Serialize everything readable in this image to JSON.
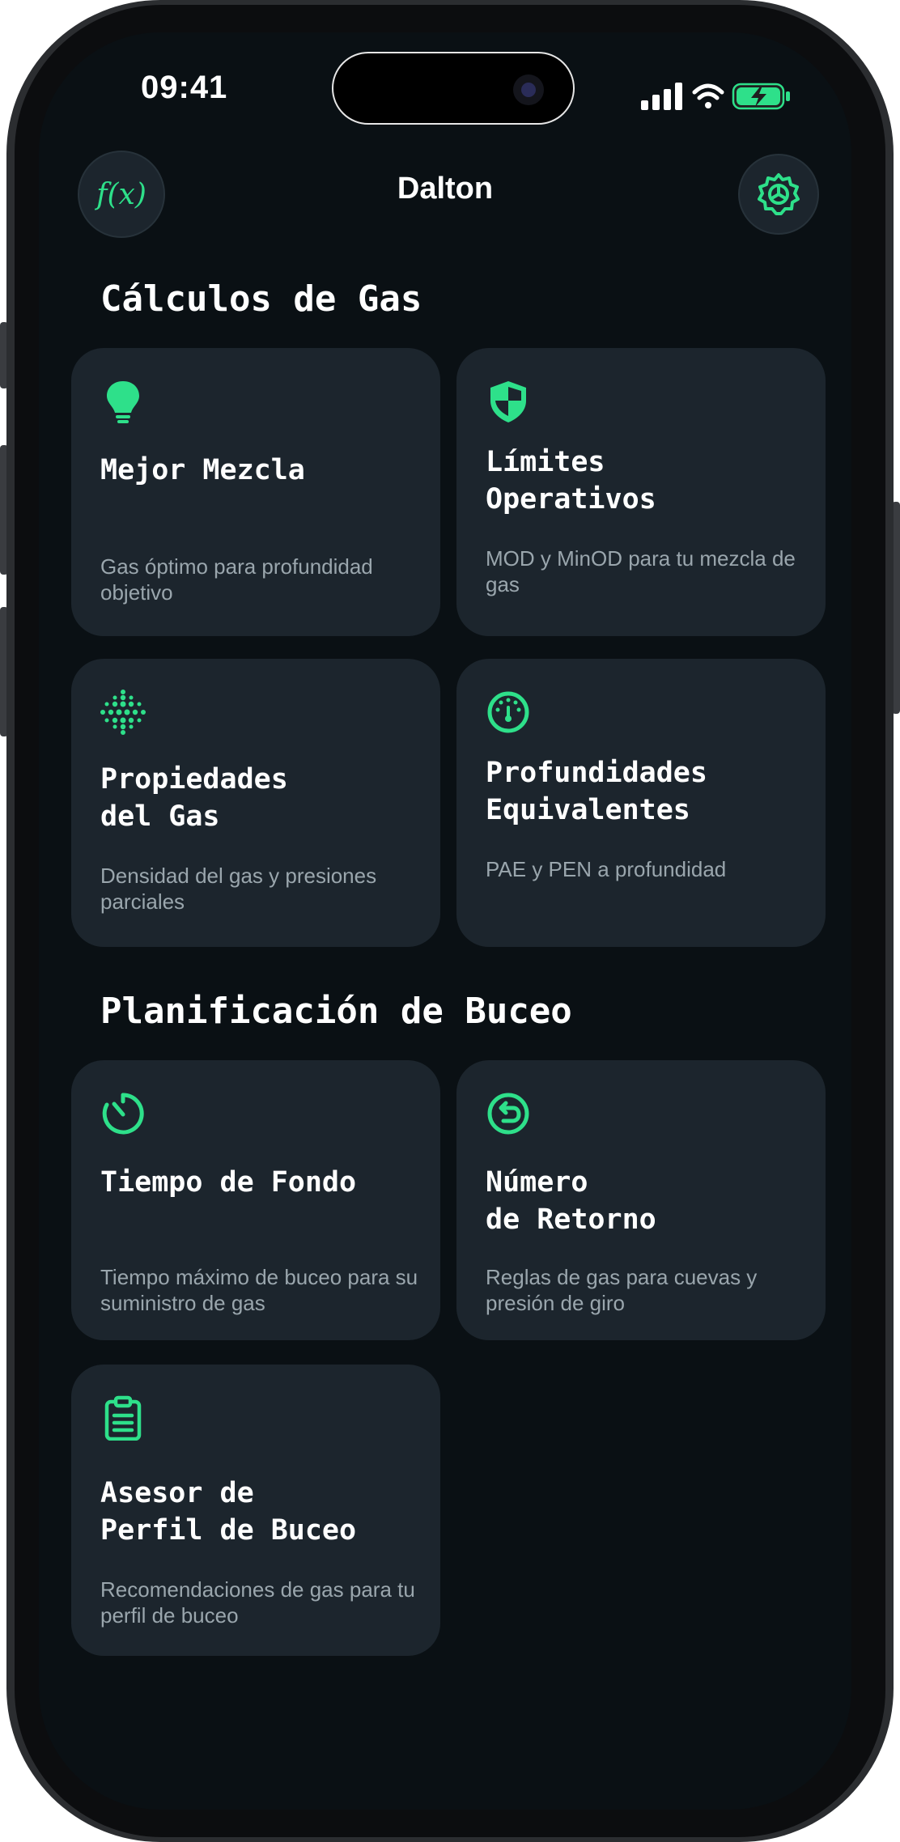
{
  "status_bar": {
    "time": "09:41"
  },
  "nav": {
    "title": "Dalton",
    "left_button_icon": "function-icon",
    "left_button_text": "f(x)",
    "right_button_icon": "gear-icon"
  },
  "colors": {
    "accent": "#2ee08a",
    "card": "#1c252d",
    "background": "#0a1014",
    "subtitle": "#9aa6ad"
  },
  "sections": [
    {
      "title": "Cálculos de Gas",
      "cards": [
        {
          "icon": "lightbulb-icon",
          "title": "Mejor Mezcla",
          "subtitle": "Gas óptimo para profundidad objetivo"
        },
        {
          "icon": "shield-icon",
          "title": "Límites\nOperativos",
          "subtitle": "MOD y MinOD para tu mezcla de gas"
        },
        {
          "icon": "dots-grid-icon",
          "title": "Propiedades\ndel Gas",
          "subtitle": "Densidad del gas y presiones parciales"
        },
        {
          "icon": "gauge-icon",
          "title": "Profundidades\nEquivalentes",
          "subtitle": "PAE y PEN a profundidad"
        }
      ]
    },
    {
      "title": "Planificación de Buceo",
      "cards": [
        {
          "icon": "timer-icon",
          "title": "Tiempo de Fondo",
          "subtitle": "Tiempo máximo de buceo para su suministro de gas"
        },
        {
          "icon": "return-arrow-icon",
          "title": "Número\nde Retorno",
          "subtitle": "Reglas de gas para cuevas y presión de giro"
        },
        {
          "icon": "clipboard-icon",
          "title": "Asesor de\nPerfil de Buceo",
          "subtitle": "Recomendaciones de gas para tu perfil de buceo"
        }
      ]
    }
  ]
}
